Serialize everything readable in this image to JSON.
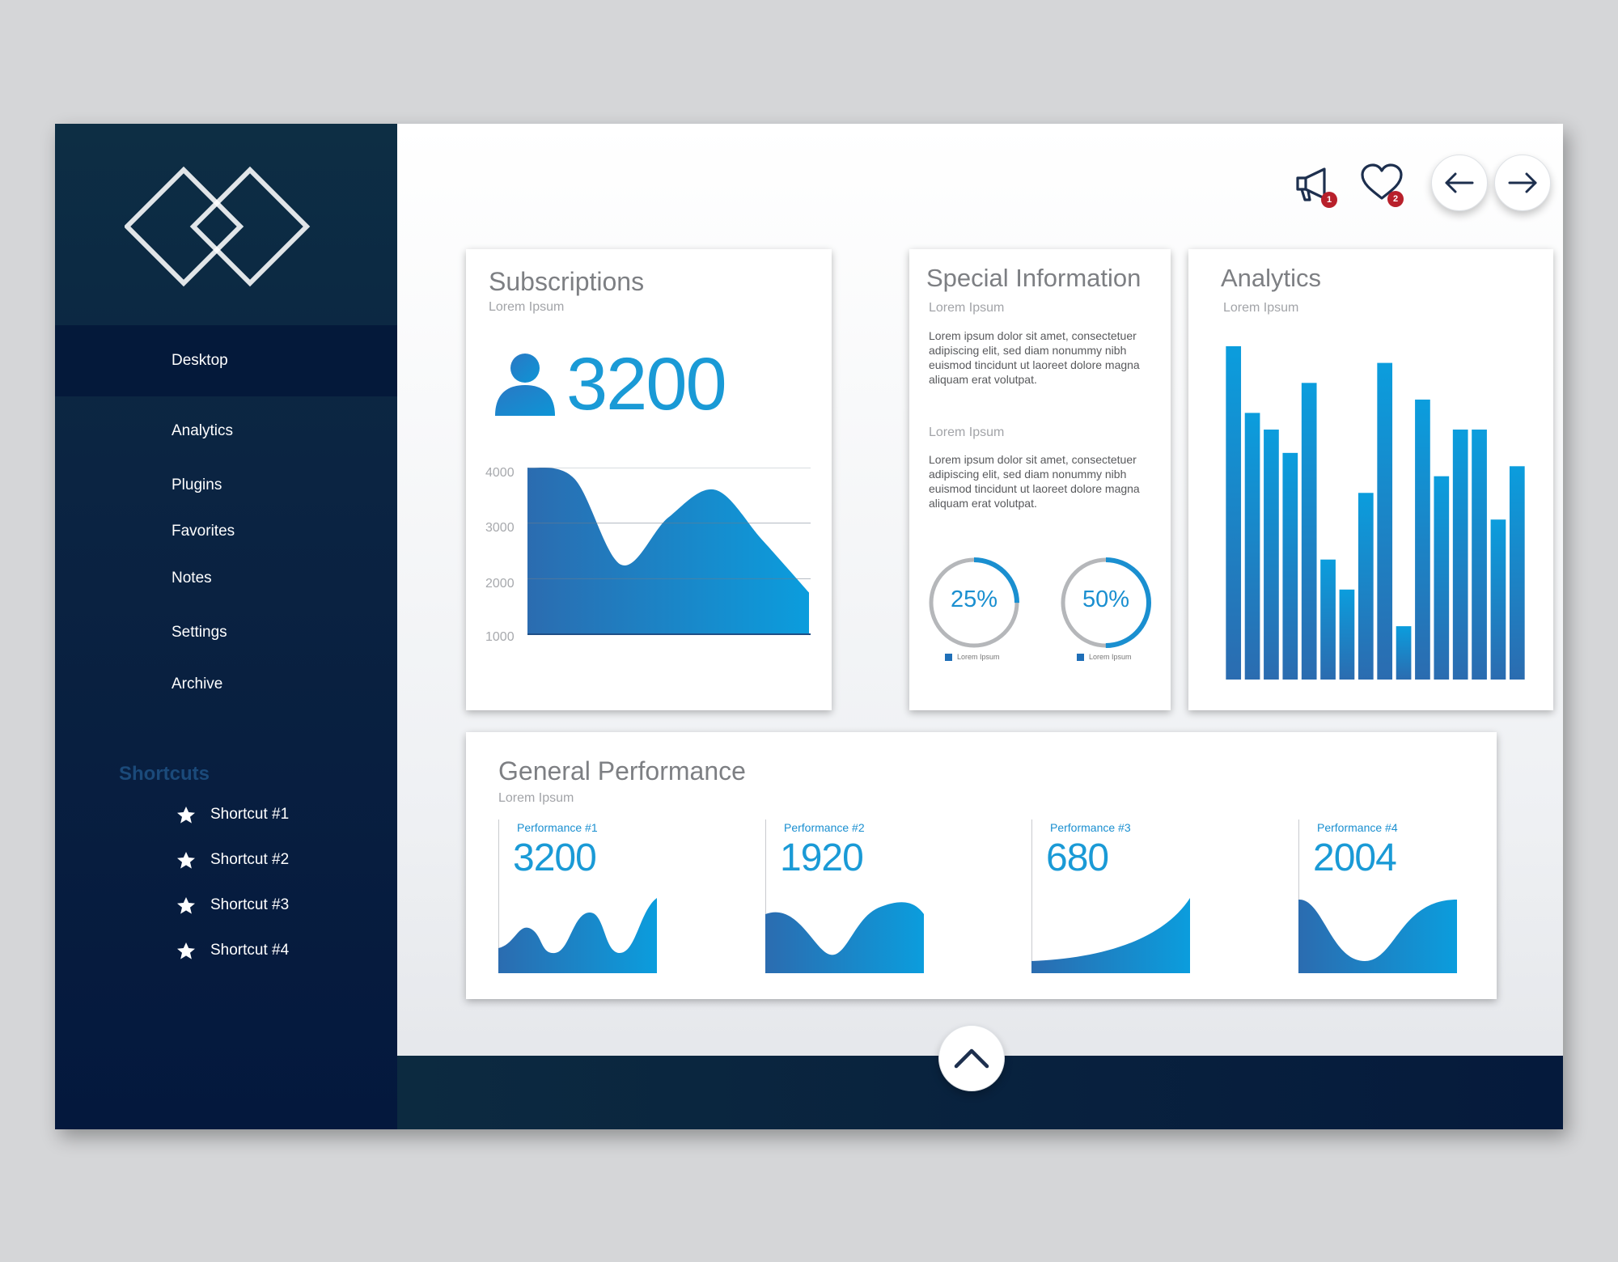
{
  "sidebar": {
    "items": [
      {
        "label": "Desktop",
        "active": true
      },
      {
        "label": "Analytics"
      },
      {
        "label": "Plugins"
      },
      {
        "label": "Favorites"
      },
      {
        "label": "Notes"
      },
      {
        "label": "Settings"
      },
      {
        "label": "Archive"
      }
    ],
    "shortcuts_title": "Shortcuts",
    "shortcuts": [
      "Shortcut #1",
      "Shortcut #2",
      "Shortcut #3",
      "Shortcut #4"
    ]
  },
  "header": {
    "notifications_badge": "1",
    "favorites_badge": "2"
  },
  "subscriptions": {
    "title": "Subscriptions",
    "subtitle": "Lorem Ipsum",
    "count": "3200",
    "chart_data": {
      "type": "area",
      "y_ticks": [
        "4000",
        "3000",
        "2000",
        "1000"
      ],
      "ylim": [
        1000,
        4000
      ],
      "x": [
        0,
        1,
        2,
        3,
        4,
        5,
        6
      ],
      "values": [
        4000,
        3800,
        2250,
        3100,
        3600,
        2700,
        1750
      ]
    }
  },
  "special_info": {
    "title": "Special Information",
    "subtitle1": "Lorem Ipsum",
    "text1": "Lorem ipsum dolor sit amet, consectetuer adipiscing elit, sed diam nonummy nibh euismod tincidunt ut laoreet dolore magna aliquam erat volutpat.",
    "subtitle2": "Lorem Ipsum",
    "text2": "Lorem ipsum dolor sit amet, consectetuer adipiscing elit, sed diam nonummy nibh euismod tincidunt ut laoreet dolore magna aliquam erat volutpat.",
    "donuts": [
      {
        "label": "25%",
        "value": 0.25,
        "legend": "Lorem Ipsum"
      },
      {
        "label": "50%",
        "value": 0.5,
        "legend": "Lorem Ipsum"
      }
    ]
  },
  "analytics": {
    "title": "Analytics",
    "subtitle": "Lorem Ipsum",
    "chart_data": {
      "type": "bar",
      "values": [
        100,
        80,
        75,
        68,
        89,
        36,
        27,
        56,
        95,
        16,
        84,
        61,
        75,
        75,
        48,
        64
      ],
      "ylim": [
        0,
        100
      ]
    }
  },
  "general_performance": {
    "title": "General Performance",
    "subtitle": "Lorem Ipsum",
    "items": [
      {
        "label": "Performance #1",
        "value": "3200"
      },
      {
        "label": "Performance #2",
        "value": "1920"
      },
      {
        "label": "Performance #3",
        "value": "680"
      },
      {
        "label": "Performance #4",
        "value": "2004"
      }
    ]
  },
  "colors": {
    "sidebar": "#0b2442",
    "accent": "#1a9ad6",
    "accent_dark": "#2b6cb0",
    "badge": "#b8202b"
  },
  "icons": {
    "notifications": "megaphone-icon",
    "favorites": "heart-icon",
    "back": "arrow-left-icon",
    "forward": "arrow-right-icon",
    "scroll_up": "chevron-up-icon",
    "user": "user-icon",
    "shortcut": "star-icon"
  }
}
